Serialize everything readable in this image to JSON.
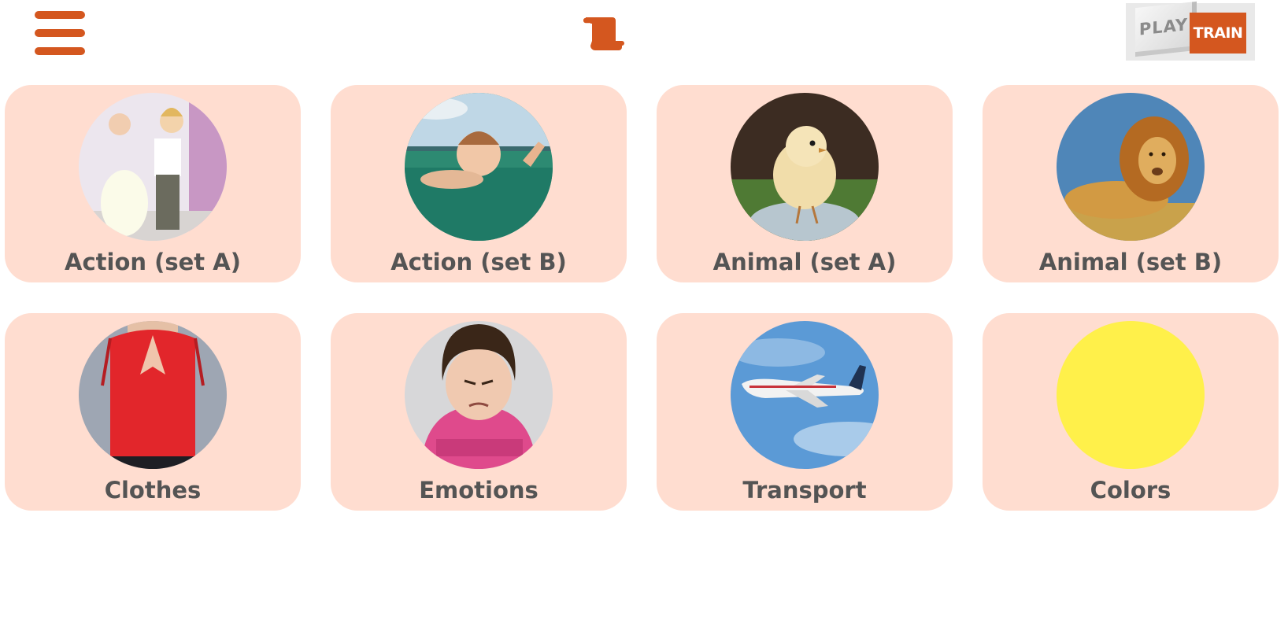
{
  "header": {
    "menu_icon": "hamburger-menu-icon",
    "scroll_icon": "scroll-icon",
    "mode_toggle": {
      "play_label": "PLAY",
      "train_label": "TRAIN"
    }
  },
  "colors": {
    "accent": "#d4571f",
    "card_background": "#ffddd0",
    "label_text": "#545454"
  },
  "categories": [
    {
      "label": "Action (set A)",
      "image": "children-dancing"
    },
    {
      "label": "Action (set B)",
      "image": "child-swimming"
    },
    {
      "label": "Animal (set A)",
      "image": "chick"
    },
    {
      "label": "Animal (set B)",
      "image": "lion"
    },
    {
      "label": "Clothes",
      "image": "red-blouse"
    },
    {
      "label": "Emotions",
      "image": "grumpy-girl"
    },
    {
      "label": "Transport",
      "image": "airplane"
    },
    {
      "label": "Colors",
      "image": "yellow"
    }
  ]
}
